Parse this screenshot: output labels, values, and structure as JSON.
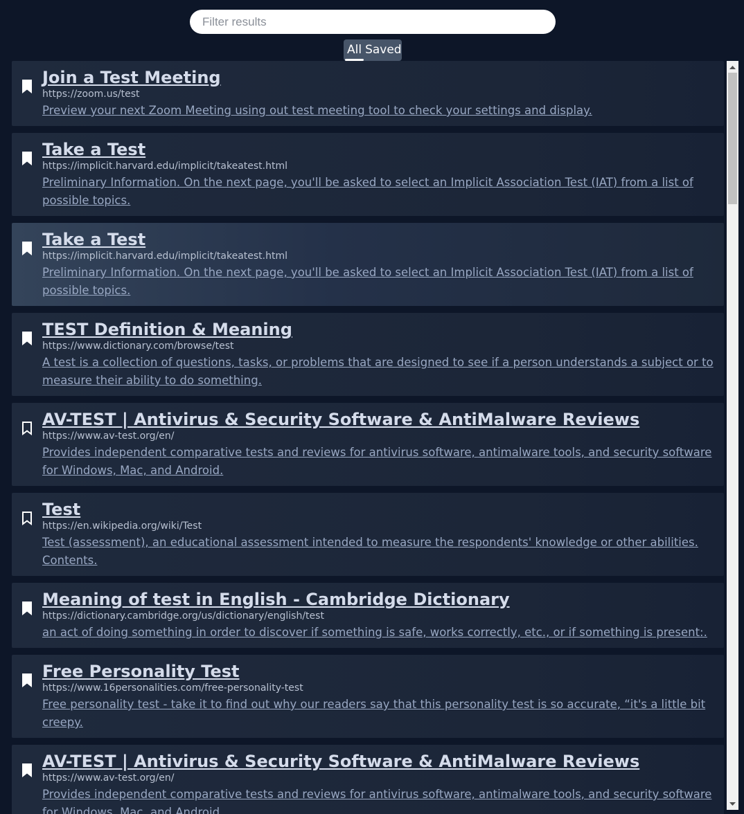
{
  "search": {
    "placeholder": "Filter results",
    "value": ""
  },
  "toggle": {
    "all_label": "All",
    "saved_label": "Saved",
    "active": "All"
  },
  "icons": {
    "bookmark_saved": "bookmark-filled-icon",
    "bookmark_unsaved": "bookmark-outline-icon"
  },
  "colors": {
    "background": "#0d1628",
    "card": "#1e293b",
    "title": "#d5dceb",
    "description": "#98a7c2",
    "toggle_bg": "#475569"
  },
  "results": [
    {
      "title": "Join a Test Meeting",
      "url": "https://zoom.us/test",
      "description": "Preview your next Zoom Meeting using out test meeting tool to check your settings and display.",
      "saved": true,
      "highlighted": false
    },
    {
      "title": "Take a Test",
      "url": "https://implicit.harvard.edu/implicit/takeatest.html",
      "description": "Preliminary Information. On the next page, you'll be asked to select an Implicit Association Test (IAT) from a list of possible topics.",
      "saved": true,
      "highlighted": false
    },
    {
      "title": "Take a Test",
      "url": "https://implicit.harvard.edu/implicit/takeatest.html",
      "description": "Preliminary Information. On the next page, you'll be asked to select an Implicit Association Test (IAT) from a list of possible topics.",
      "saved": true,
      "highlighted": true
    },
    {
      "title": "TEST Definition & Meaning",
      "url": "https://www.dictionary.com/browse/test",
      "description": "A test is a collection of questions, tasks, or problems that are designed to see if a person understands a subject or to measure their ability to do something.",
      "saved": true,
      "highlighted": false
    },
    {
      "title": "AV-TEST | Antivirus & Security Software & AntiMalware Reviews",
      "url": "https://www.av-test.org/en/",
      "description": "Provides independent comparative tests and reviews for antivirus software, antimalware tools, and security software for Windows, Mac, and Android.",
      "saved": false,
      "highlighted": false
    },
    {
      "title": "Test",
      "url": "https://en.wikipedia.org/wiki/Test",
      "description": "Test (assessment), an educational assessment intended to measure the respondents' knowledge or other abilities. Contents.",
      "saved": false,
      "highlighted": false
    },
    {
      "title": "Meaning of test in English - Cambridge Dictionary",
      "url": "https://dictionary.cambridge.org/us/dictionary/english/test",
      "description": "an act of doing something in order to discover if something is safe, works correctly, etc., or if something is present:.",
      "saved": true,
      "highlighted": false
    },
    {
      "title": "Free Personality Test",
      "url": "https://www.16personalities.com/free-personality-test",
      "description": "Free personality test - take it to find out why our readers say that this personality test is so accurate, “it's a little bit creepy.",
      "saved": true,
      "highlighted": false
    },
    {
      "title": "AV-TEST | Antivirus & Security Software & AntiMalware Reviews",
      "url": "https://www.av-test.org/en/",
      "description": "Provides independent comparative tests and reviews for antivirus software, antimalware tools, and security software for Windows, Mac, and Android.",
      "saved": true,
      "highlighted": false
    }
  ]
}
